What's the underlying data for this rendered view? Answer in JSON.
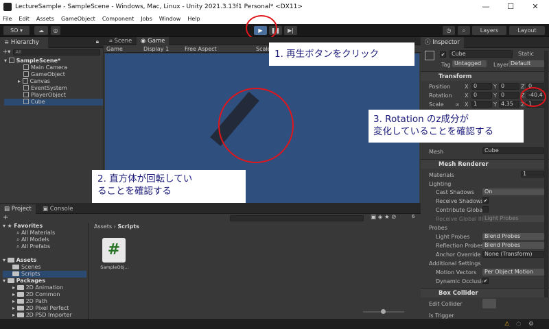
{
  "window": {
    "title": "LectureSample - SampleScene - Windows, Mac, Linux - Unity 2021.3.13f1 Personal* <DX11>",
    "min": "—",
    "max": "☐",
    "close": "✕"
  },
  "menu": [
    "File",
    "Edit",
    "Assets",
    "GameObject",
    "Component",
    "Jobs",
    "Window",
    "Help"
  ],
  "toolbar": {
    "account": "SO ▾",
    "play": "▶",
    "pause": "❚❚",
    "step": "▶|",
    "layers": "Layers",
    "layout": "Layout"
  },
  "hierarchy": {
    "tab": "Hierarchy",
    "search": "All",
    "scene": "SampleScene*",
    "items": [
      "Main Camera",
      "GameObject",
      "Canvas",
      "EventSystem",
      "PlayerObject",
      "Cube"
    ]
  },
  "scene_tabs": {
    "scene": "Scene",
    "game": "Game"
  },
  "gamebar": {
    "mode": "Game",
    "display": "Display 1",
    "aspect": "Free Aspect",
    "scale": "Scale"
  },
  "callouts": {
    "c1": "1. 再生ボタンをクリック",
    "c2_l1": "2. 直方体が回転してい",
    "c2_l2": "ることを確認する",
    "c3_l1": "3. Rotation のz成分が",
    "c3_l2": "変化していることを確認する"
  },
  "project": {
    "tab_project": "Project",
    "tab_console": "Console",
    "add": "+",
    "breadcrumb_root": "Assets",
    "breadcrumb_sep": "›",
    "breadcrumb_leaf": "Scripts",
    "badge": "6",
    "asset_name": "SampleObj...",
    "asset_glyph": "#",
    "tree": [
      {
        "label": "Favorites",
        "level": 0,
        "bold": true
      },
      {
        "label": "All Materials",
        "level": 1
      },
      {
        "label": "All Models",
        "level": 1
      },
      {
        "label": "All Prefabs",
        "level": 1
      },
      {
        "label": "",
        "level": 0
      },
      {
        "label": "Assets",
        "level": 0,
        "bold": true
      },
      {
        "label": "Scenes",
        "level": 1
      },
      {
        "label": "Scripts",
        "level": 1
      },
      {
        "label": "Packages",
        "level": 0,
        "bold": true
      },
      {
        "label": "2D Animation",
        "level": 1
      },
      {
        "label": "2D Common",
        "level": 1
      },
      {
        "label": "2D Path",
        "level": 1
      },
      {
        "label": "2D Pixel Perfect",
        "level": 1
      },
      {
        "label": "2D PSD Importer",
        "level": 1
      }
    ]
  },
  "inspector": {
    "tab": "Inspector",
    "name": "Cube",
    "static": "Static",
    "tag_label": "Tag",
    "tag": "Untagged",
    "layer_label": "Layer",
    "layer": "Default",
    "transform": "Transform",
    "position": {
      "label": "Position",
      "x": "0",
      "y": "0",
      "z": "0"
    },
    "rotation": {
      "label": "Rotation",
      "x": "0",
      "y": "0",
      "z": "-40.4"
    },
    "scale": {
      "label": "Scale",
      "x": "1",
      "y": "4.35",
      "z": "1"
    },
    "axis": {
      "x": "X",
      "y": "Y",
      "z": "Z"
    },
    "mesh_label": "Mesh",
    "mesh": "Cube",
    "mesh_renderer": "Mesh Renderer",
    "materials": "Materials",
    "materials_count": "1",
    "lighting": "Lighting",
    "cast_shadows": "Cast Shadows",
    "cast_shadows_val": "On",
    "receive_shadows": "Receive Shadows",
    "contribute_gi": "Contribute Global I",
    "receive_gi": "Receive Global Illu",
    "receive_gi_val": "Light Probes",
    "probes": "Probes",
    "light_probes": "Light Probes",
    "light_probes_val": "Blend Probes",
    "reflection_probes": "Reflection Probes",
    "reflection_probes_val": "Blend Probes",
    "anchor_override": "Anchor Override",
    "anchor_override_val": "None (Transform)",
    "additional": "Additional Settings",
    "motion_vectors": "Motion Vectors",
    "motion_vectors_val": "Per Object Motion",
    "dynamic_occlusion": "Dynamic Occlusio",
    "box_collider": "Box Collider",
    "edit_collider": "Edit Collider",
    "is_trigger": "Is Trigger",
    "check": "✔"
  }
}
